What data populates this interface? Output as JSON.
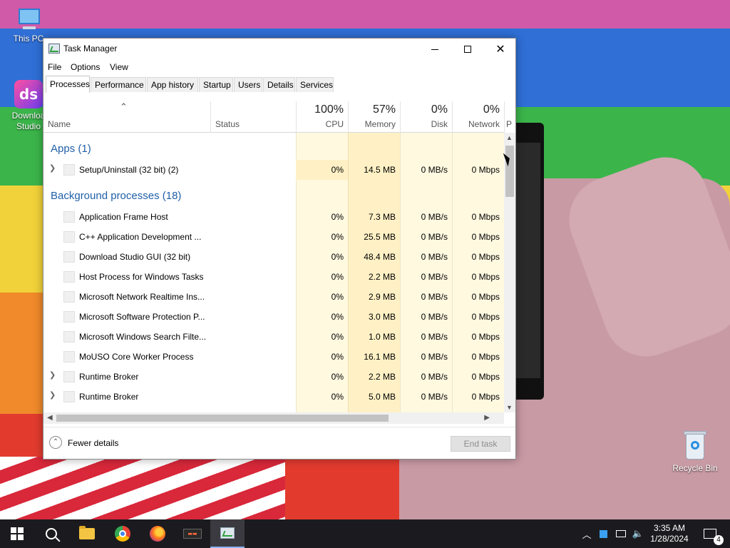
{
  "desktop": {
    "icons": {
      "this_pc": "This PC",
      "download_studio": "Downloa\nStudio",
      "recycle_bin": "Recycle Bin"
    }
  },
  "window": {
    "title": "Task Manager",
    "menu": [
      "File",
      "Options",
      "View"
    ],
    "tabs": [
      "Processes",
      "Performance",
      "App history",
      "Startup",
      "Users",
      "Details",
      "Services"
    ],
    "active_tab": "Processes",
    "columns": {
      "name": "Name",
      "status": "Status",
      "cpu": {
        "pct": "100%",
        "label": "CPU"
      },
      "memory": {
        "pct": "57%",
        "label": "Memory"
      },
      "disk": {
        "pct": "0%",
        "label": "Disk"
      },
      "network": {
        "pct": "0%",
        "label": "Network"
      },
      "partial": "P"
    },
    "groups": {
      "apps": "Apps (1)",
      "background": "Background processes (18)"
    },
    "apps": [
      {
        "name": "Setup/Uninstall (32 bit) (2)",
        "cpu": "0%",
        "memory": "14.5 MB",
        "disk": "0 MB/s",
        "network": "0 Mbps"
      }
    ],
    "background": [
      {
        "name": "Application Frame Host",
        "cpu": "0%",
        "memory": "7.3 MB",
        "disk": "0 MB/s",
        "network": "0 Mbps"
      },
      {
        "name": "C++ Application Development ...",
        "cpu": "0%",
        "memory": "25.5 MB",
        "disk": "0 MB/s",
        "network": "0 Mbps"
      },
      {
        "name": "Download Studio GUI (32 bit)",
        "cpu": "0%",
        "memory": "48.4 MB",
        "disk": "0 MB/s",
        "network": "0 Mbps"
      },
      {
        "name": "Host Process for Windows Tasks",
        "cpu": "0%",
        "memory": "2.2 MB",
        "disk": "0 MB/s",
        "network": "0 Mbps"
      },
      {
        "name": "Microsoft Network Realtime Ins...",
        "cpu": "0%",
        "memory": "2.9 MB",
        "disk": "0 MB/s",
        "network": "0 Mbps"
      },
      {
        "name": "Microsoft Software Protection P...",
        "cpu": "0%",
        "memory": "3.0 MB",
        "disk": "0 MB/s",
        "network": "0 Mbps"
      },
      {
        "name": "Microsoft Windows Search Filte...",
        "cpu": "0%",
        "memory": "1.0 MB",
        "disk": "0 MB/s",
        "network": "0 Mbps"
      },
      {
        "name": "MoUSO Core Worker Process",
        "cpu": "0%",
        "memory": "16.1 MB",
        "disk": "0 MB/s",
        "network": "0 Mbps"
      },
      {
        "name": "Runtime Broker",
        "cpu": "0%",
        "memory": "2.2 MB",
        "disk": "0 MB/s",
        "network": "0 Mbps"
      },
      {
        "name": "Runtime Broker",
        "cpu": "0%",
        "memory": "5.0 MB",
        "disk": "0 MB/s",
        "network": "0 Mbps"
      }
    ],
    "footer": {
      "fewer_details": "Fewer details",
      "end_task": "End task"
    }
  },
  "taskbar": {
    "clock_time": "3:35 AM",
    "clock_date": "1/28/2024",
    "notification_count": "4",
    "pinned": [
      "start-icon",
      "search-icon",
      "file-explorer-icon",
      "chrome-icon",
      "firefox-icon",
      "app-icon",
      "task-manager-icon"
    ]
  }
}
